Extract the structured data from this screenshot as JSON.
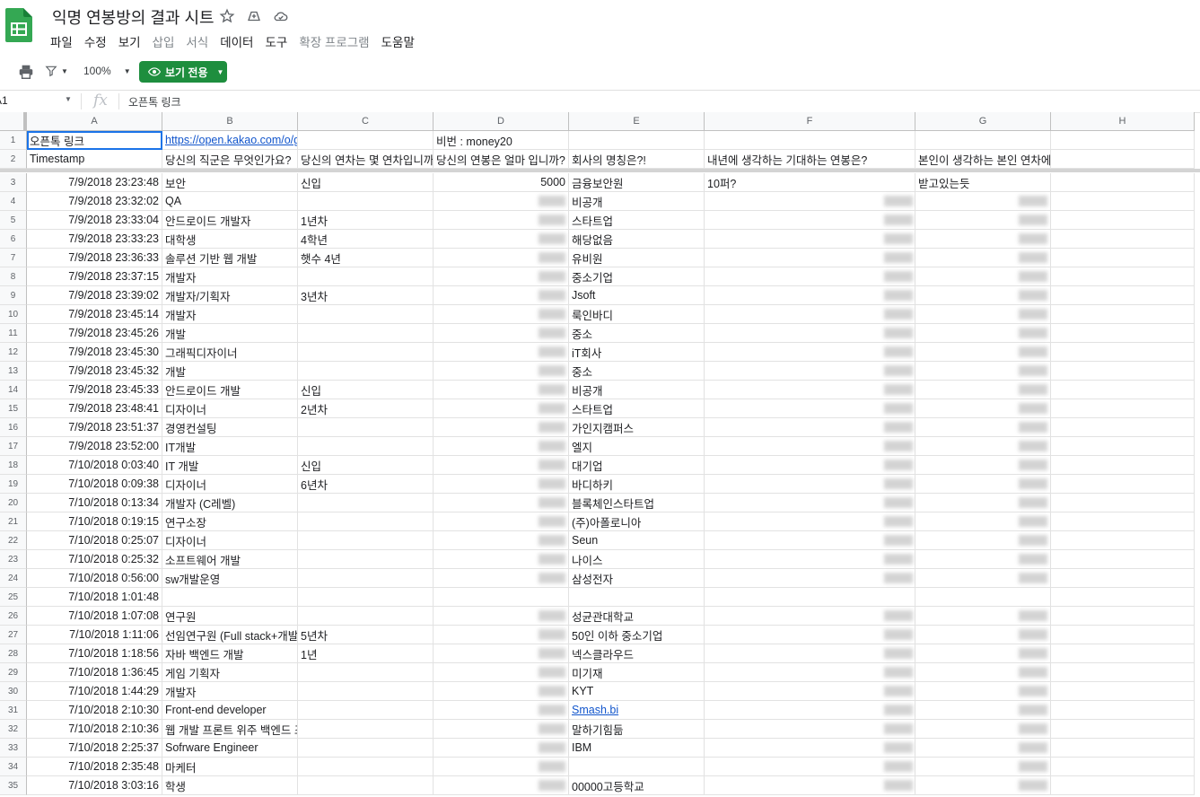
{
  "doc": {
    "title": "익명 연봉방의 결과 시트",
    "icons": [
      "star-icon",
      "move-to-drive-icon",
      "cloud-status-icon"
    ]
  },
  "menu": [
    {
      "label": "파일",
      "disabled": false
    },
    {
      "label": "수정",
      "disabled": false
    },
    {
      "label": "보기",
      "disabled": false
    },
    {
      "label": "삽입",
      "disabled": true
    },
    {
      "label": "서식",
      "disabled": true
    },
    {
      "label": "데이터",
      "disabled": false
    },
    {
      "label": "도구",
      "disabled": false
    },
    {
      "label": "확장 프로그램",
      "disabled": true
    },
    {
      "label": "도움말",
      "disabled": false
    }
  ],
  "toolbar": {
    "zoom": "100%",
    "view_only": "보기 전용"
  },
  "formula_bar": {
    "cell_ref": "A1",
    "content": "오픈톡 링크"
  },
  "columns": [
    "A",
    "B",
    "C",
    "D",
    "E",
    "F",
    "G",
    "H"
  ],
  "rows": [
    [
      "1",
      "오픈톡 링크",
      "https://open.kakao.com/o/gBAhcUSc",
      "",
      "비번 : money20",
      "",
      "",
      "",
      ""
    ],
    [
      "2",
      "Timestamp",
      "당신의 직군은 무엇인가요?",
      "당신의 연차는 몇 연차입니까",
      "당신의 연봉은 얼마 입니까?",
      "회사의 명칭은?!",
      "내년에 생각하는 기대하는 연봉은?",
      "본인이 생각하는 본인 연차에 받아야 하는 연봉은?",
      ""
    ],
    [
      "3",
      "7/9/2018 23:23:48",
      "보안",
      "신입",
      "5000",
      "금융보안원",
      "10퍼?",
      "받고있는듯",
      ""
    ],
    [
      "4",
      "7/9/2018 23:32:02",
      "QA",
      "",
      "",
      "비공개",
      "",
      "",
      ""
    ],
    [
      "5",
      "7/9/2018 23:33:04",
      "안드로이드 개발자",
      "1년차",
      "",
      "스타트업",
      "",
      "",
      ""
    ],
    [
      "6",
      "7/9/2018 23:33:23",
      "대학생",
      "4학년",
      "",
      "해당없음",
      "",
      "",
      ""
    ],
    [
      "7",
      "7/9/2018 23:36:33",
      "솔루션 기반 웹 개발",
      "햇수 4년",
      "",
      "유비원",
      "",
      "",
      ""
    ],
    [
      "8",
      "7/9/2018 23:37:15",
      "개발자",
      "",
      "",
      "중소기업",
      "",
      "",
      ""
    ],
    [
      "9",
      "7/9/2018 23:39:02",
      "개발자/기획자",
      "3년차",
      "",
      "Jsoft",
      "",
      "",
      ""
    ],
    [
      "10",
      "7/9/2018 23:45:14",
      "개발자",
      "",
      "",
      "룩인바디",
      "",
      "",
      ""
    ],
    [
      "11",
      "7/9/2018 23:45:26",
      "개발",
      "",
      "",
      "중소",
      "",
      "",
      ""
    ],
    [
      "12",
      "7/9/2018 23:45:30",
      "그래픽디자이너",
      "",
      "",
      "iT회사",
      "",
      "",
      ""
    ],
    [
      "13",
      "7/9/2018 23:45:32",
      "개발",
      "",
      "",
      "중소",
      "",
      "",
      ""
    ],
    [
      "14",
      "7/9/2018 23:45:33",
      "안드로이드 개발",
      "신입",
      "",
      "비공개",
      "",
      "",
      ""
    ],
    [
      "15",
      "7/9/2018 23:48:41",
      "디자이너",
      "2년차",
      "",
      "스타트업",
      "",
      "",
      ""
    ],
    [
      "16",
      "7/9/2018 23:51:37",
      "경영컨설팅",
      "",
      "",
      "가인지캠퍼스",
      "",
      "",
      ""
    ],
    [
      "17",
      "7/9/2018 23:52:00",
      "IT개발",
      "",
      "",
      "엘지",
      "",
      "",
      ""
    ],
    [
      "18",
      "7/10/2018 0:03:40",
      "IT 개발",
      "신입",
      "",
      "대기업",
      "",
      "",
      ""
    ],
    [
      "19",
      "7/10/2018 0:09:38",
      "디자이너",
      "6년차",
      "",
      "바디하키",
      "",
      "",
      ""
    ],
    [
      "20",
      "7/10/2018 0:13:34",
      "개발자 (C레벨)",
      "",
      "",
      "블록체인스타트업",
      "",
      "",
      ""
    ],
    [
      "21",
      "7/10/2018 0:19:15",
      "연구소장",
      "",
      "",
      "(주)아폴로니아",
      "",
      "",
      ""
    ],
    [
      "22",
      "7/10/2018 0:25:07",
      "디자이너",
      "",
      "",
      "Seun",
      "",
      "",
      ""
    ],
    [
      "23",
      "7/10/2018 0:25:32",
      "소프트웨어 개발",
      "",
      "",
      "나이스",
      "",
      "",
      ""
    ],
    [
      "24",
      "7/10/2018 0:56:00",
      "sw개발운영",
      "",
      "",
      "삼성전자",
      "",
      "",
      ""
    ],
    [
      "25",
      "7/10/2018 1:01:48",
      "",
      "",
      "",
      "",
      "",
      "",
      ""
    ],
    [
      "26",
      "7/10/2018 1:07:08",
      "연구원",
      "",
      "",
      "성균관대학교",
      "",
      "",
      ""
    ],
    [
      "27",
      "7/10/2018 1:11:06",
      "선임연구원 (Full stack+개발",
      "5년차",
      "",
      "50인 이하 중소기업",
      "",
      "",
      ""
    ],
    [
      "28",
      "7/10/2018 1:18:56",
      "자바 백엔드 개발",
      "1년",
      "",
      "넥스클라우드",
      "",
      "",
      ""
    ],
    [
      "29",
      "7/10/2018 1:36:45",
      "게임 기획자",
      "",
      "",
      "미기재",
      "",
      "",
      ""
    ],
    [
      "30",
      "7/10/2018 1:44:29",
      "개발자",
      "",
      "",
      "KYT",
      "",
      "",
      ""
    ],
    [
      "31",
      "7/10/2018 2:10:30",
      "Front-end developer",
      "",
      "",
      "Smash.bi",
      "",
      "",
      ""
    ],
    [
      "32",
      "7/10/2018 2:10:36",
      "웹 개발 프론트 위주 백엔드 조",
      "",
      "",
      "말하기힘듦",
      "",
      "",
      ""
    ],
    [
      "33",
      "7/10/2018 2:25:37",
      "Sofrware Engineer",
      "",
      "",
      "IBM",
      "",
      "",
      ""
    ],
    [
      "34",
      "7/10/2018 2:35:48",
      "마케터",
      "",
      "",
      "",
      "",
      "",
      ""
    ],
    [
      "35",
      "7/10/2018 3:03:16",
      "학생",
      "",
      "",
      "00000고등학교",
      "",
      "",
      ""
    ]
  ]
}
